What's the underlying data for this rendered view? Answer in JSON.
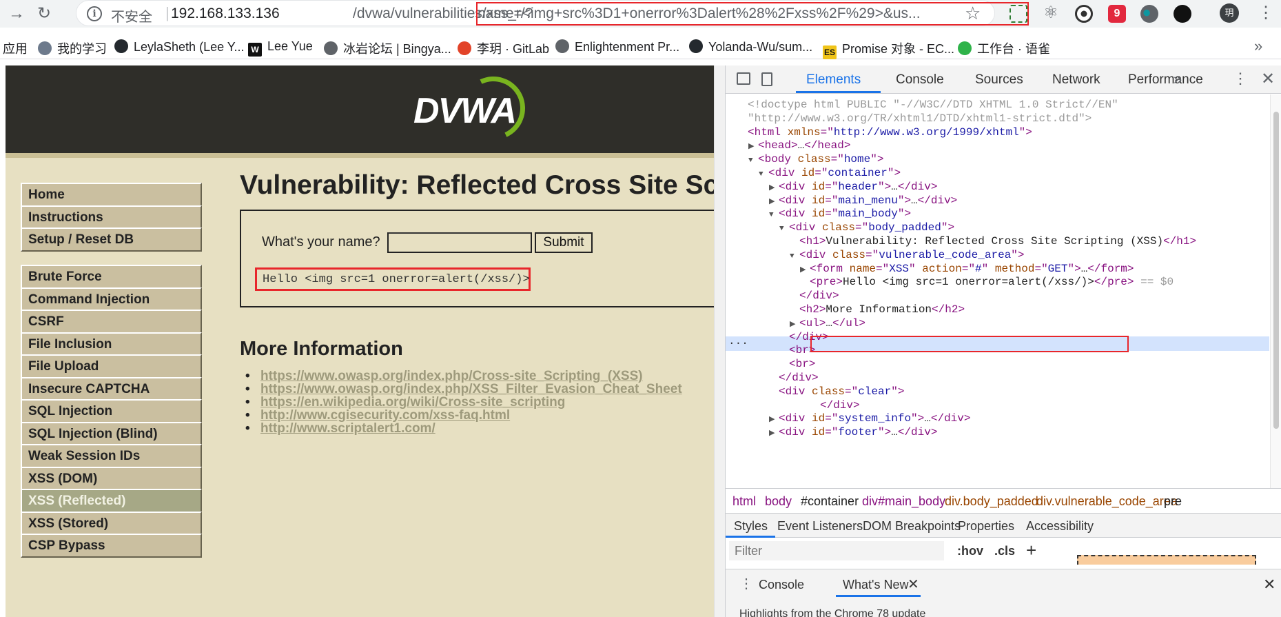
{
  "browser": {
    "address": {
      "security_label": "不安全",
      "separator": "|",
      "host": "192.168.133.136",
      "path": "/dvwa/vulnerabilities/xss_r/?",
      "query": "name=<img+src%3D1+onerror%3Dalert%28%2Fxss%2F%29>&us..."
    },
    "profile_initial": "玥",
    "bookmarks": [
      {
        "label": "应用",
        "icon": "apps-icon",
        "color": "#4285f4"
      },
      {
        "label": "我的学习",
        "icon": "folder-icon",
        "color": "#6d7a8c"
      },
      {
        "label": "LeylaSheth (Lee Y...",
        "icon": "github-icon",
        "color": "#24292e"
      },
      {
        "label": "Lee Yue",
        "icon": "w-icon",
        "color": "#111111"
      },
      {
        "label": "冰岩论坛 | Bingya...",
        "icon": "globe-icon",
        "color": "#5f6368"
      },
      {
        "label": "李玥 · GitLab",
        "icon": "gitlab-icon",
        "color": "#e24329"
      },
      {
        "label": "Enlightenment Pr...",
        "icon": "globe-icon",
        "color": "#5f6368"
      },
      {
        "label": "Yolanda-Wu/sum...",
        "icon": "github-icon",
        "color": "#24292e"
      },
      {
        "label": "Promise 对象 - EC...",
        "icon": "es-icon",
        "color": "#f0c419"
      },
      {
        "label": "工作台 · 语雀",
        "icon": "yuque-icon",
        "color": "#2fb34a"
      }
    ]
  },
  "dvwa": {
    "logo_text": "DVWA",
    "menu": {
      "group1": [
        "Home",
        "Instructions",
        "Setup / Reset DB"
      ],
      "group2": [
        "Brute Force",
        "Command Injection",
        "CSRF",
        "File Inclusion",
        "File Upload",
        "Insecure CAPTCHA",
        "SQL Injection",
        "SQL Injection (Blind)",
        "Weak Session IDs",
        "XSS (DOM)",
        "XSS (Reflected)",
        "XSS (Stored)",
        "CSP Bypass"
      ],
      "selected": "XSS (Reflected)"
    },
    "title": "Vulnerability: Reflected Cross Site Scripting (XSS)",
    "form": {
      "label": "What's your name?",
      "input_value": "",
      "submit_label": "Submit"
    },
    "output": "Hello <img src=1 onerror=alert(/xss/)>",
    "more_info_heading": "More Information",
    "links": [
      "https://www.owasp.org/index.php/Cross-site_Scripting_(XSS)",
      "https://www.owasp.org/index.php/XSS_Filter_Evasion_Cheat_Sheet",
      "https://en.wikipedia.org/wiki/Cross-site_scripting",
      "http://www.cgisecurity.com/xss-faq.html",
      "http://www.scriptalert1.com/"
    ]
  },
  "devtools": {
    "tabs": [
      "Elements",
      "Console",
      "Sources",
      "Network",
      "Performance"
    ],
    "active_tab": "Elements",
    "more_tabs_glyph": "»",
    "dom_lines": [
      {
        "indent": 0,
        "tri": "",
        "parts": [
          [
            "cm",
            "<!doctype html PUBLIC \"-//W3C//DTD XHTML 1.0 Strict//EN\""
          ]
        ]
      },
      {
        "indent": 0,
        "tri": "",
        "parts": [
          [
            "cm",
            "\"http://www.w3.org/TR/xhtml1/DTD/xhtml1-strict.dtd\">"
          ]
        ]
      },
      {
        "indent": 0,
        "tri": "",
        "parts": [
          [
            "t",
            "<html "
          ],
          [
            "an",
            "xmlns"
          ],
          [
            "t",
            "=\""
          ],
          [
            "av",
            "http://www.w3.org/1999/xhtml"
          ],
          [
            "t",
            "\">"
          ]
        ]
      },
      {
        "indent": 1,
        "tri": "▶",
        "parts": [
          [
            "t",
            "<head>"
          ],
          [
            "tx",
            "…"
          ],
          [
            "t",
            "</head>"
          ]
        ]
      },
      {
        "indent": 1,
        "tri": "▼",
        "parts": [
          [
            "t",
            "<body "
          ],
          [
            "an",
            "class"
          ],
          [
            "t",
            "=\""
          ],
          [
            "av",
            "home"
          ],
          [
            "t",
            "\">"
          ]
        ]
      },
      {
        "indent": 2,
        "tri": "▼",
        "parts": [
          [
            "t",
            "<div "
          ],
          [
            "an",
            "id"
          ],
          [
            "t",
            "=\""
          ],
          [
            "av",
            "container"
          ],
          [
            "t",
            "\">"
          ]
        ]
      },
      {
        "indent": 3,
        "tri": "▶",
        "parts": [
          [
            "t",
            "<div "
          ],
          [
            "an",
            "id"
          ],
          [
            "t",
            "=\""
          ],
          [
            "av",
            "header"
          ],
          [
            "t",
            "\">"
          ],
          [
            "tx",
            "…"
          ],
          [
            "t",
            "</div>"
          ]
        ]
      },
      {
        "indent": 3,
        "tri": "▶",
        "parts": [
          [
            "t",
            "<div "
          ],
          [
            "an",
            "id"
          ],
          [
            "t",
            "=\""
          ],
          [
            "av",
            "main_menu"
          ],
          [
            "t",
            "\">"
          ],
          [
            "tx",
            "…"
          ],
          [
            "t",
            "</div>"
          ]
        ]
      },
      {
        "indent": 3,
        "tri": "▼",
        "parts": [
          [
            "t",
            "<div "
          ],
          [
            "an",
            "id"
          ],
          [
            "t",
            "=\""
          ],
          [
            "av",
            "main_body"
          ],
          [
            "t",
            "\">"
          ]
        ]
      },
      {
        "indent": 4,
        "tri": "▼",
        "parts": [
          [
            "t",
            "<div "
          ],
          [
            "an",
            "class"
          ],
          [
            "t",
            "=\""
          ],
          [
            "av",
            "body_padded"
          ],
          [
            "t",
            "\">"
          ]
        ]
      },
      {
        "indent": 5,
        "tri": "",
        "parts": [
          [
            "t",
            "<h1>"
          ],
          [
            "tx",
            "Vulnerability: Reflected Cross Site Scripting (XSS)"
          ],
          [
            "t",
            "</h1>"
          ]
        ]
      },
      {
        "indent": 5,
        "tri": "▼",
        "parts": [
          [
            "t",
            "<div "
          ],
          [
            "an",
            "class"
          ],
          [
            "t",
            "=\""
          ],
          [
            "av",
            "vulnerable_code_area"
          ],
          [
            "t",
            "\">"
          ]
        ]
      },
      {
        "indent": 6,
        "tri": "▶",
        "parts": [
          [
            "t",
            "<form "
          ],
          [
            "an",
            "name"
          ],
          [
            "t",
            "=\""
          ],
          [
            "av",
            "XSS"
          ],
          [
            "t",
            "\" "
          ],
          [
            "an",
            "action"
          ],
          [
            "t",
            "=\""
          ],
          [
            "av",
            "#"
          ],
          [
            "t",
            "\" "
          ],
          [
            "an",
            "method"
          ],
          [
            "t",
            "=\""
          ],
          [
            "av",
            "GET"
          ],
          [
            "t",
            "\">"
          ],
          [
            "tx",
            "…"
          ],
          [
            "t",
            "</form>"
          ]
        ]
      },
      {
        "indent": 6,
        "tri": "",
        "parts": [
          [
            "t",
            "<pre>"
          ],
          [
            "tx",
            "Hello <img src=1 onerror=alert(/xss/)>"
          ],
          [
            "t",
            "</pre>"
          ],
          [
            "cm",
            " == $0"
          ]
        ]
      },
      {
        "indent": 5,
        "tri": "",
        "parts": [
          [
            "t",
            "</div>"
          ]
        ]
      },
      {
        "indent": 5,
        "tri": "",
        "parts": [
          [
            "t",
            "<h2>"
          ],
          [
            "tx",
            "More Information"
          ],
          [
            "t",
            "</h2>"
          ]
        ]
      },
      {
        "indent": 5,
        "tri": "▶",
        "parts": [
          [
            "t",
            "<ul>"
          ],
          [
            "tx",
            "…"
          ],
          [
            "t",
            "</ul>"
          ]
        ]
      },
      {
        "indent": 4,
        "tri": "",
        "parts": [
          [
            "t",
            "</div>"
          ]
        ]
      },
      {
        "indent": 4,
        "tri": "",
        "parts": [
          [
            "t",
            "<br>"
          ]
        ]
      },
      {
        "indent": 4,
        "tri": "",
        "parts": [
          [
            "t",
            "<br>"
          ]
        ]
      },
      {
        "indent": 3,
        "tri": "",
        "parts": [
          [
            "t",
            "</div>"
          ]
        ]
      },
      {
        "indent": 3,
        "tri": "",
        "parts": [
          [
            "t",
            "<div "
          ],
          [
            "an",
            "class"
          ],
          [
            "t",
            "=\""
          ],
          [
            "av",
            "clear"
          ],
          [
            "t",
            "\">"
          ]
        ]
      },
      {
        "indent": 7,
        "tri": "",
        "parts": [
          [
            "t",
            "</div>"
          ]
        ]
      },
      {
        "indent": 3,
        "tri": "▶",
        "parts": [
          [
            "t",
            "<div "
          ],
          [
            "an",
            "id"
          ],
          [
            "t",
            "=\""
          ],
          [
            "av",
            "system_info"
          ],
          [
            "t",
            "\">"
          ],
          [
            "tx",
            "…"
          ],
          [
            "t",
            "</div>"
          ]
        ]
      },
      {
        "indent": 3,
        "tri": "▶",
        "parts": [
          [
            "t",
            "<div "
          ],
          [
            "an",
            "id"
          ],
          [
            "t",
            "=\""
          ],
          [
            "av",
            "footer"
          ],
          [
            "t",
            "\">"
          ],
          [
            "tx",
            "…"
          ],
          [
            "t",
            "</div>"
          ]
        ]
      }
    ],
    "selected_dots": "...",
    "breadcrumbs": [
      {
        "label": "html",
        "kind": "tag"
      },
      {
        "label": "body",
        "kind": "tag"
      },
      {
        "label": "#container",
        "kind": "id"
      },
      {
        "label": "div#main_body",
        "kind": "id"
      },
      {
        "label": "div.body_padded",
        "kind": "cls"
      },
      {
        "label": "div.vulnerable_code_area",
        "kind": "cls"
      },
      {
        "label": "pre",
        "kind": "plain"
      }
    ],
    "style_tabs": [
      "Styles",
      "Event Listeners",
      "DOM Breakpoints",
      "Properties",
      "Accessibility"
    ],
    "filter_placeholder": "Filter",
    "hov_label": ":hov",
    "cls_label": ".cls",
    "add_rule_glyph": "+",
    "drawer_tabs": [
      "Console",
      "What's New"
    ],
    "drawer_active": "What's New",
    "drawer_content": "Highlights from the Chrome 78 update"
  }
}
